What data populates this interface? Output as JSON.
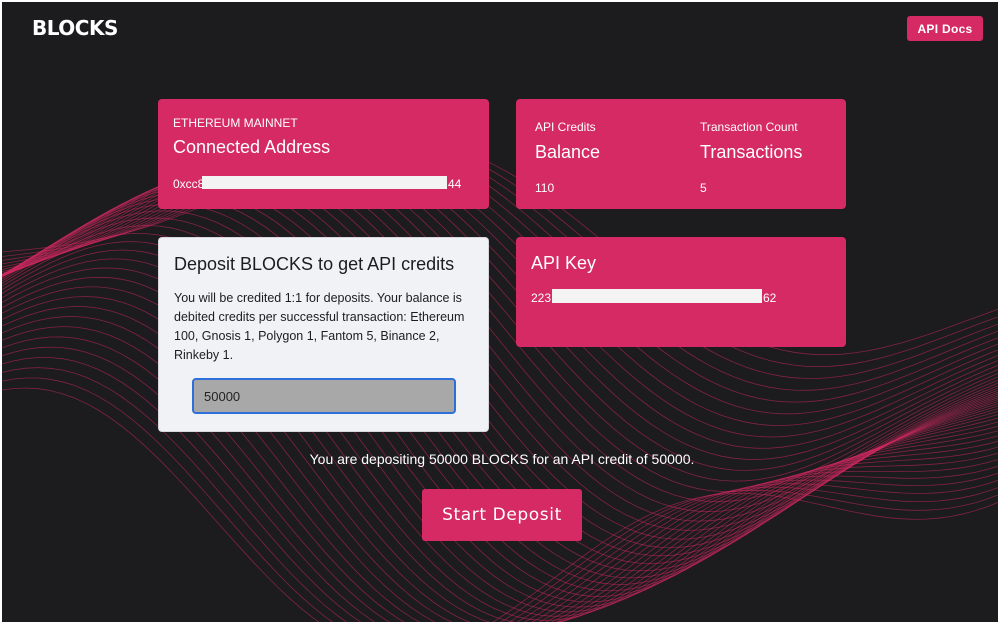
{
  "colors": {
    "background": "#1c1b1d",
    "accent": "#d52a63",
    "card_light": "#f1f2f6",
    "input_fill": "#a8a8a8",
    "input_border": "#2f6fd8"
  },
  "header": {
    "brand": "BLOCKS",
    "docs_label": "API Docs"
  },
  "network_card": {
    "network": "ETHEREUM MAINNET",
    "title": "Connected Address",
    "address_prefix": "0xcc8",
    "address_suffix": "44"
  },
  "stats_card": {
    "credits_label": "API Credits",
    "credits_title": "Balance",
    "credits_value": "110",
    "tx_label": "Transaction Count",
    "tx_title": "Transactions",
    "tx_value": "5"
  },
  "deposit_card": {
    "title": "Deposit BLOCKS to get API credits",
    "description": "You will be credited 1:1 for deposits. Your balance is debited credits per successful transaction: Ethereum 100, Gnosis 1, Polygon 1, Fantom 5, Binance 2, Rinkeby 1.",
    "amount": "50000"
  },
  "api_key_card": {
    "title": "API Key",
    "key_prefix": "223",
    "key_suffix": "62"
  },
  "notice": "You are depositing 50000 BLOCKS for an API credit of 50000.",
  "deposit_button": "Start Deposit",
  "background_art": "wave-lines"
}
